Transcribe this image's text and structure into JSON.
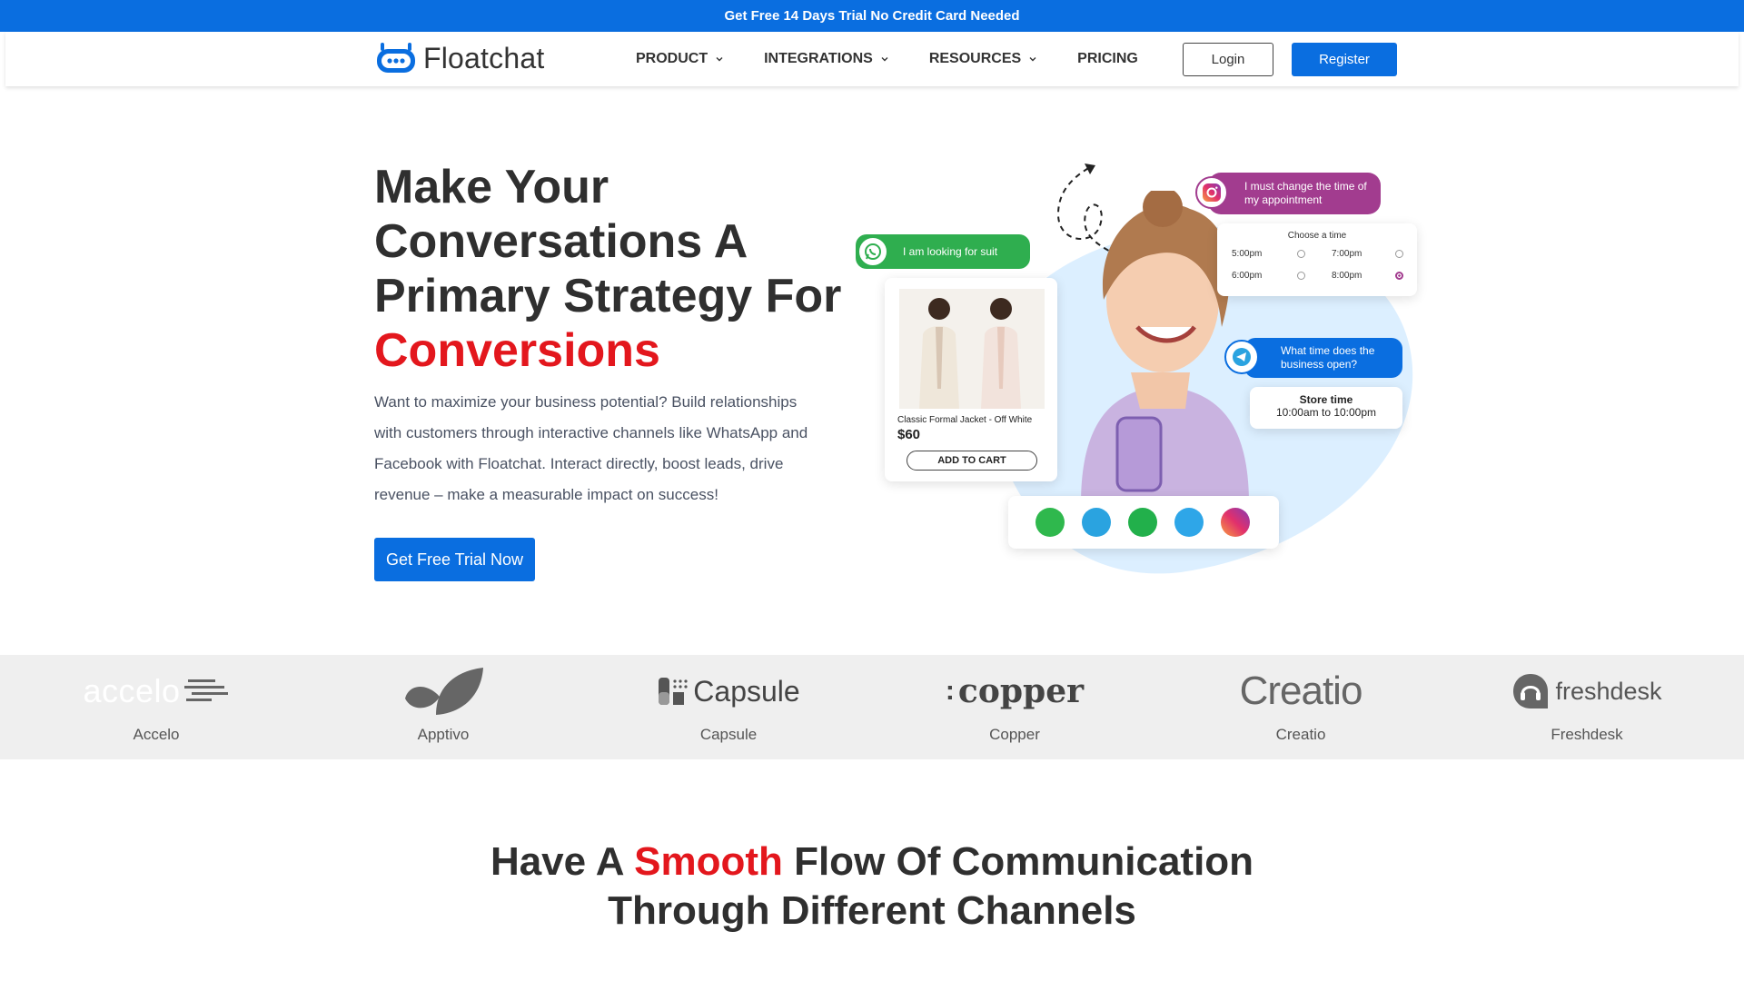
{
  "announcement": {
    "text": "Get Free 14 Days Trial No Credit Card Needed"
  },
  "header": {
    "logo_text": "Floatchat",
    "nav": [
      {
        "label": "PRODUCT",
        "has_dropdown": true
      },
      {
        "label": "INTEGRATIONS",
        "has_dropdown": true
      },
      {
        "label": "RESOURCES",
        "has_dropdown": true
      },
      {
        "label": "PRICING",
        "has_dropdown": false
      }
    ],
    "login_label": "Login",
    "register_label": "Register"
  },
  "hero": {
    "title_line1": "Make Your",
    "title_line2": "Conversations A",
    "title_line3": "Primary Strategy For",
    "title_accent": "Conversions",
    "description": "Want to maximize your business potential? Build relationships with customers through interactive channels like WhatsApp and Facebook with Floatchat. Interact directly, boost leads, drive revenue – make a measurable impact on success!",
    "cta_label": "Get Free Trial Now"
  },
  "illustration": {
    "instagram_msg": "I must change the time of my appointment",
    "choose_time_title": "Choose a time",
    "times": [
      "5:00pm",
      "7:00pm",
      "6:00pm",
      "8:00pm"
    ],
    "selected_time": "8:00pm",
    "whatsapp_msg": "I am looking for suit",
    "product_name": "Classic Formal Jacket - Off White",
    "product_price": "$60",
    "add_to_cart": "ADD TO CART",
    "telegram_msg": "What time does the business open?",
    "store_time_title": "Store time",
    "store_time_value": "10:00am to 10:00pm",
    "channels": [
      "whatsapp-icon",
      "telegram-icon",
      "wechat-icon",
      "twitter-icon",
      "instagram-icon"
    ]
  },
  "brands": [
    {
      "name": "Accelo",
      "logo": "accelo"
    },
    {
      "name": "Apptivo",
      "logo": ""
    },
    {
      "name": "Capsule",
      "logo": "Capsule"
    },
    {
      "name": "Copper",
      "logo": "copper"
    },
    {
      "name": "Creatio",
      "logo": "Creatio"
    },
    {
      "name": "Freshdesk",
      "logo": "freshdesk"
    }
  ],
  "section": {
    "title_before": "Have A ",
    "title_accent": "Smooth",
    "title_after": " Flow Of Communication",
    "title_line2": "Through Different Channels"
  },
  "colors": {
    "brand_blue": "#0a6ee0",
    "accent_red": "#e3171d",
    "strip_bg": "#efefef"
  }
}
